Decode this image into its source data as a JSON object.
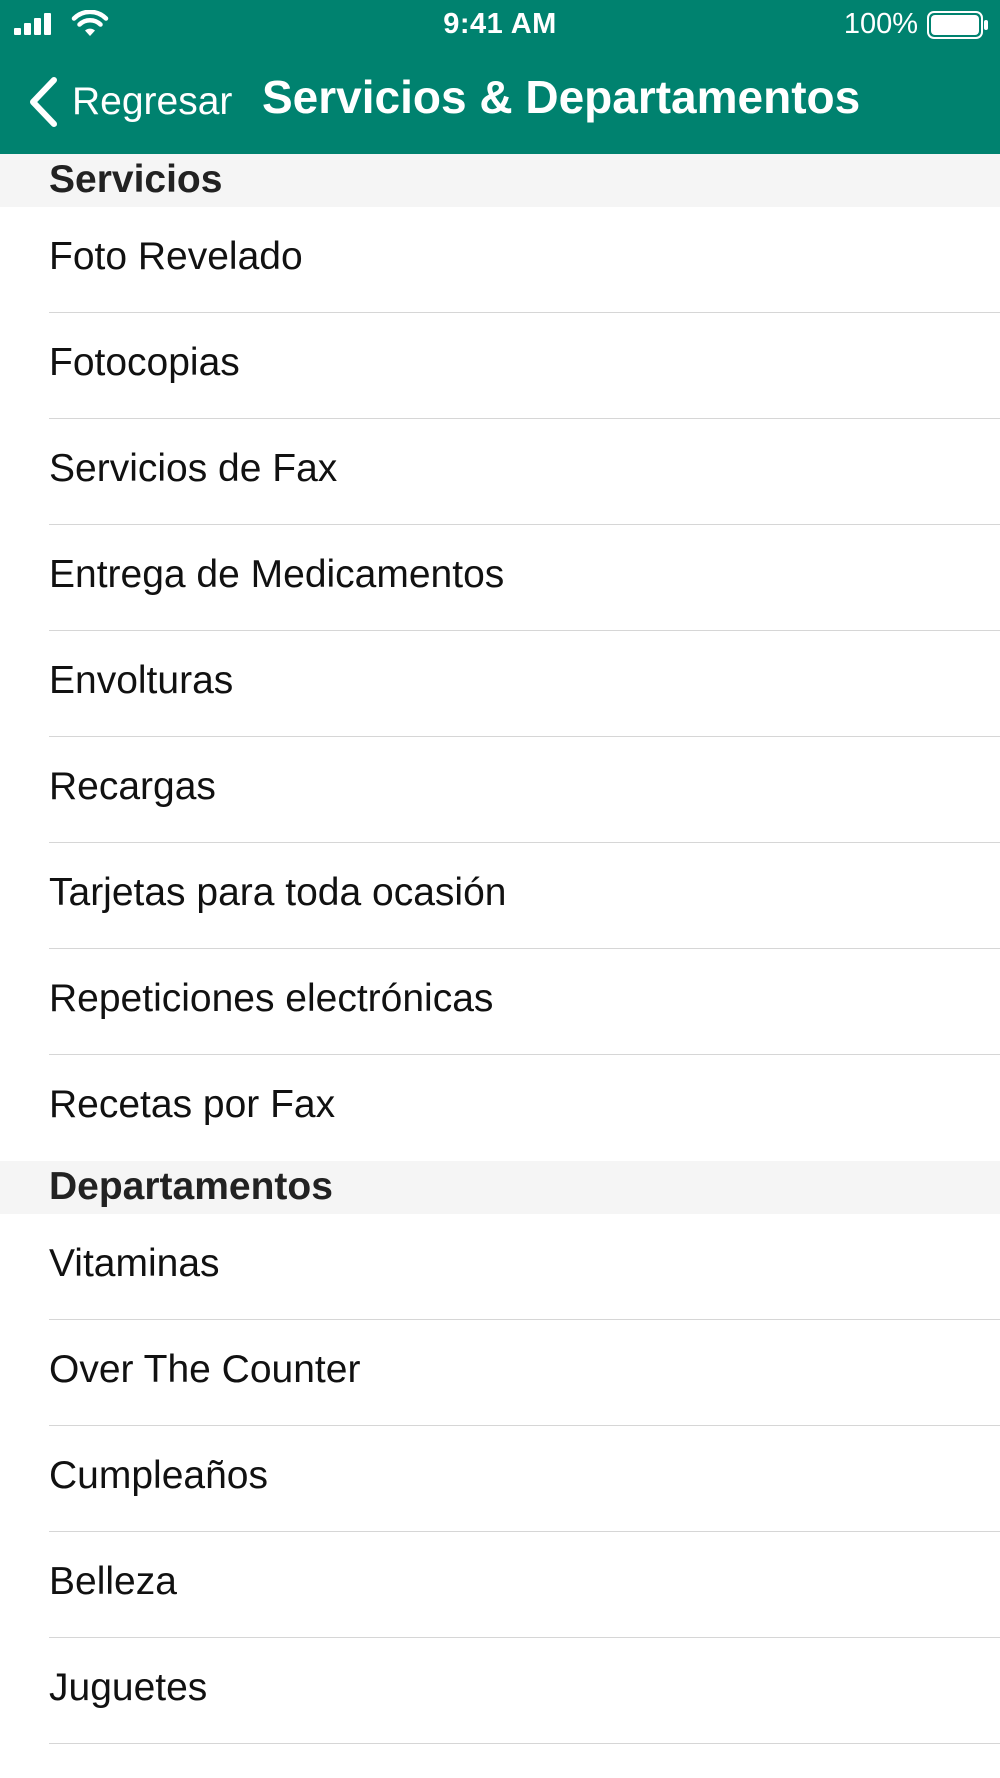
{
  "status_bar": {
    "time": "9:41 AM",
    "battery": "100%",
    "icons": [
      "signal-icon",
      "wifi-icon",
      "battery-icon"
    ]
  },
  "nav": {
    "back_label": "Regresar",
    "title": "Servicios & Departamentos",
    "back_icon": "chevron-left-icon"
  },
  "colors": {
    "header": "#00826F",
    "section_bg": "#f5f5f5",
    "separator": "#d6d6d6"
  },
  "sections": [
    {
      "title": "Servicios",
      "items": [
        "Foto Revelado",
        "Fotocopias",
        "Servicios de Fax",
        "Entrega de Medicamentos",
        "Envolturas",
        "Recargas",
        "Tarjetas para toda ocasión",
        "Repeticiones electrónicas",
        "Recetas por Fax"
      ]
    },
    {
      "title": "Departamentos",
      "items": [
        "Vitaminas",
        "Over The Counter",
        "Cumpleaños",
        "Belleza",
        "Juguetes"
      ]
    }
  ]
}
